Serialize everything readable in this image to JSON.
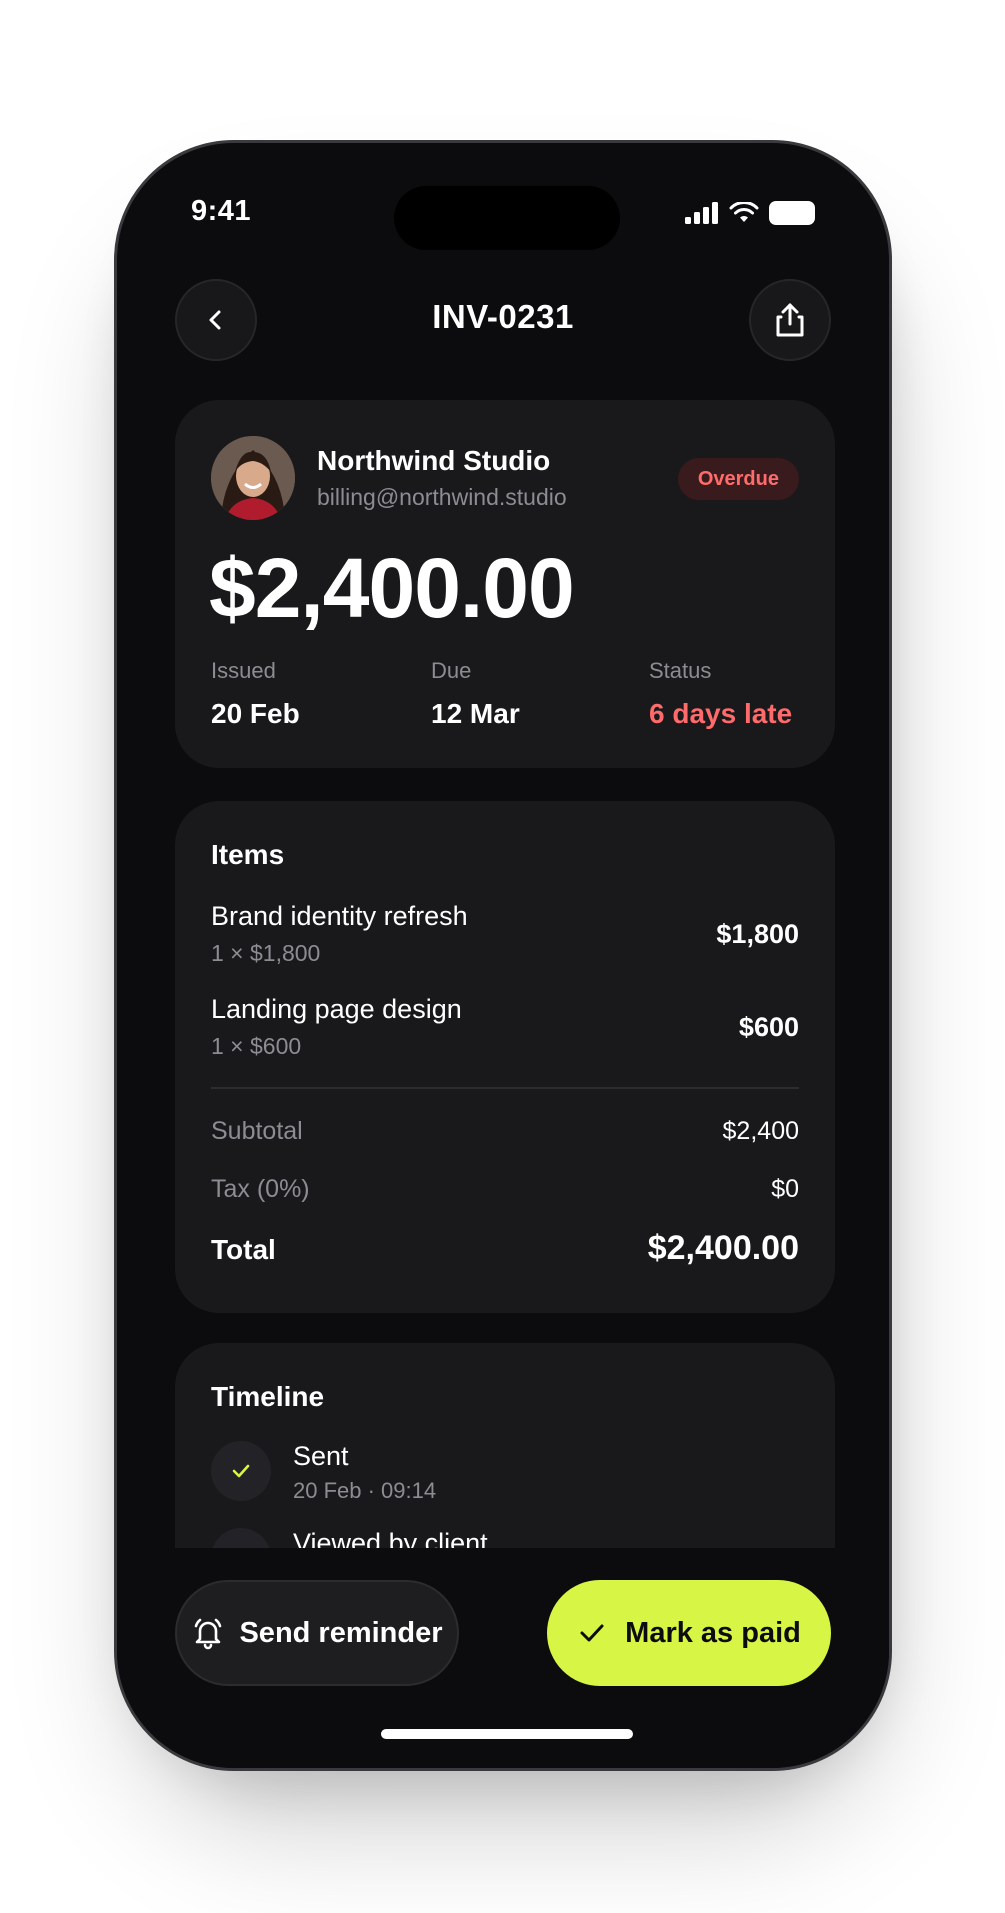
{
  "status_bar": {
    "time": "9:41"
  },
  "header": {
    "title": "INV-0231"
  },
  "client": {
    "name": "Northwind Studio",
    "email": "billing@northwind.studio",
    "badge": "Overdue"
  },
  "invoice": {
    "amount": "$2,400.00",
    "meta": [
      {
        "label": "Issued",
        "value": "20 Feb"
      },
      {
        "label": "Due",
        "value": "12 Mar"
      },
      {
        "label": "Status",
        "value": "6 days late"
      }
    ]
  },
  "items": {
    "title": "Items",
    "list": [
      {
        "name": "Brand identity refresh",
        "qty": "1 × $1,800",
        "price": "$1,800"
      },
      {
        "name": "Landing page design",
        "qty": "1 × $600",
        "price": "$600"
      }
    ],
    "subtotal_label": "Subtotal",
    "subtotal_value": "$2,400",
    "tax_label": "Tax (0%)",
    "tax_value": "$0",
    "total_label": "Total",
    "total_value": "$2,400.00"
  },
  "timeline": {
    "title": "Timeline",
    "events": [
      {
        "title": "Sent",
        "time": "20 Feb · 09:14"
      },
      {
        "title": "Viewed by client",
        "time": ""
      }
    ]
  },
  "actions": {
    "reminder_label": "Send reminder",
    "paid_label": "Mark as paid"
  },
  "colors": {
    "accent": "#d7f545",
    "overdue": "#ff6b6b",
    "background": "#0c0c0e",
    "card": "#19191c"
  }
}
